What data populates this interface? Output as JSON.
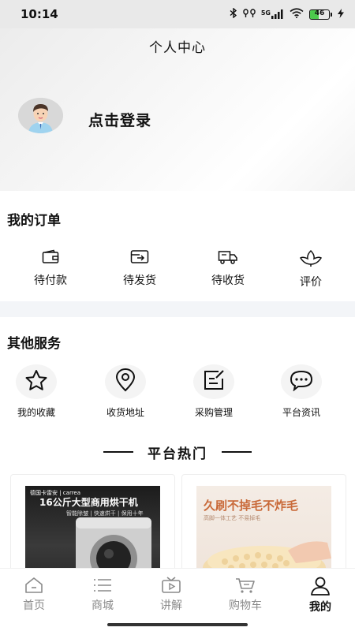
{
  "status_bar": {
    "time": "10:14",
    "network": "5G",
    "battery_level": 46,
    "battery_text": "46"
  },
  "header": {
    "title": "个人中心",
    "login_label": "点击登录"
  },
  "orders": {
    "title": "我的订单",
    "items": [
      {
        "label": "待付款",
        "icon": "wallet-icon"
      },
      {
        "label": "待发货",
        "icon": "ship-box-icon"
      },
      {
        "label": "待收货",
        "icon": "truck-icon"
      },
      {
        "label": "评价",
        "icon": "review-icon"
      }
    ]
  },
  "services": {
    "title": "其他服务",
    "items": [
      {
        "label": "我的收藏",
        "icon": "star-icon"
      },
      {
        "label": "收货地址",
        "icon": "location-pin-icon"
      },
      {
        "label": "采购管理",
        "icon": "edit-list-icon"
      },
      {
        "label": "平台资讯",
        "icon": "chat-bubble-icon"
      }
    ]
  },
  "hot": {
    "title": "平台热门",
    "products": [
      {
        "brand_text": "德国卡雷安 | carrea",
        "title": "16公斤大型商用烘干机",
        "subtitle": "智能除皱 | 快速烘干 | 保用十年"
      },
      {
        "title": "久刷不掉毛不炸毛",
        "subtitle": "高脚一体工艺 不易掉毛"
      }
    ]
  },
  "bottom_nav": {
    "items": [
      {
        "label": "首页",
        "icon": "home-icon"
      },
      {
        "label": "商城",
        "icon": "list-icon"
      },
      {
        "label": "讲解",
        "icon": "tv-icon"
      },
      {
        "label": "购物车",
        "icon": "cart-icon"
      },
      {
        "label": "我的",
        "icon": "user-icon",
        "active": true
      }
    ]
  },
  "colors": {
    "accent": "#111111",
    "battery_fill": "#4cc94c",
    "inactive_nav": "#8a8a8a"
  }
}
